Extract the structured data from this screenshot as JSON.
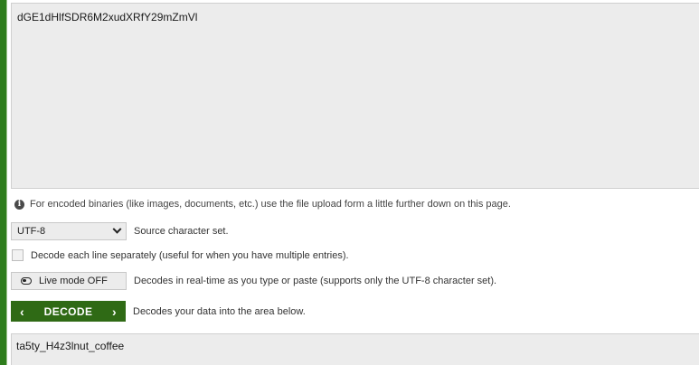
{
  "source": {
    "value": "dGE1dHlfSDR6M2xudXRfY29mZmVl"
  },
  "info": {
    "icon": "info-icon",
    "text": "For encoded binaries (like images, documents, etc.) use the file upload form a little further down on this page."
  },
  "charset": {
    "selected": "UTF-8",
    "description": "Source character set."
  },
  "separate_lines": {
    "label": "Decode each line separately (useful for when you have multiple entries).",
    "checked": false
  },
  "live_mode": {
    "label": "Live mode OFF",
    "description": "Decodes in real-time as you type or paste (supports only the UTF-8 character set)."
  },
  "decode": {
    "label": "DECODE",
    "left_arrow": "‹",
    "right_arrow": "›",
    "description": "Decodes your data into the area below."
  },
  "result": {
    "value": "ta5ty_H4z3lnut_coffee"
  },
  "colors": {
    "accent": "#2f6a15",
    "field_bg": "#ececec"
  }
}
